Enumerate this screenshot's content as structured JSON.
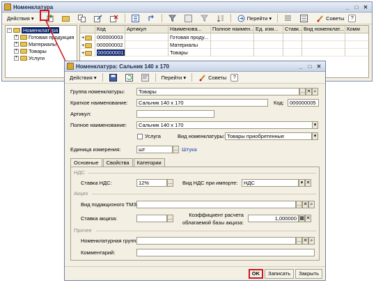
{
  "catalog_window": {
    "title": "Номенклатура",
    "toolbar": {
      "actions_label": "Действия",
      "goto_label": "Перейти",
      "advice_label": "Советы",
      "help_label": "?"
    },
    "tree": [
      {
        "label": "Номенклатура",
        "level": 0,
        "selected": true
      },
      {
        "label": "Готовая продукция",
        "level": 1
      },
      {
        "label": "Материалы",
        "level": 1
      },
      {
        "label": "Товары",
        "level": 1
      },
      {
        "label": "Услуги",
        "level": 1
      }
    ],
    "grid_columns": [
      "Код",
      "Артикул",
      "Наименова...",
      "Полное наимен...",
      "Ед. изм...",
      "Ставк...",
      "Вид номенклат...",
      "Комм"
    ],
    "grid_rows": [
      {
        "code": "000000003",
        "article": "",
        "name": "Готовая проду..."
      },
      {
        "code": "000000002",
        "article": "",
        "name": "Материалы"
      },
      {
        "code": "000000001",
        "article": "",
        "name": "Товары",
        "selected": true
      }
    ]
  },
  "item_window": {
    "title": "Номенклатура: Сальник 140 х 170",
    "toolbar": {
      "actions_label": "Действия",
      "goto_label": "Перейти",
      "advice_label": "Советы",
      "help_label": "?"
    },
    "labels": {
      "group": "Группа номенклатуры:",
      "short_name": "Краткое наименование:",
      "code": "Код:",
      "article": "Артикул:",
      "full_name": "Полное наименование:",
      "service": "Услуга",
      "nomenclature_type": "Вид номенклатуры:",
      "unit": "Единица измерения:"
    },
    "values": {
      "group": "Товары",
      "short_name": "Сальник 140 х 170",
      "code": "000000005",
      "article": "",
      "full_name": "Сальник 140 х 170",
      "nomenclature_type": "Товары приобретенные",
      "unit": "шт",
      "unit_link": "Штука"
    },
    "tabs": [
      "Основные",
      "Свойства",
      "Категории"
    ],
    "active_tab": "Основные",
    "sections": {
      "vat": "НДС",
      "excise": "Акциз",
      "other": "Прочее"
    },
    "tab_labels": {
      "vat_rate": "Ставка НДС:",
      "import_vat": "Вид НДС при импорте:",
      "excise_kind": "Вид подакцизного ТМЗ:",
      "excise_rate": "Ставка акциза:",
      "coef_line1": "Коэффициент расчета",
      "coef_line2": "облагаемой базы акциза:",
      "nomenclature_group": "Номенклатурная группа:",
      "comment": "Комментарий:"
    },
    "tab_values": {
      "vat_rate": "12%",
      "import_vat": "НДС",
      "excise_kind": "",
      "excise_rate": "",
      "coef": "1,000000",
      "nomenclature_group": "",
      "comment": ""
    },
    "footer": {
      "ok_label": "OK",
      "save_label": "Записать",
      "close_label": "Закрыть"
    }
  },
  "colors": {
    "highlight": "#d0141c",
    "selection": "#0a246a",
    "window_bg": "#f3efe3",
    "link": "#1a3fb0"
  }
}
